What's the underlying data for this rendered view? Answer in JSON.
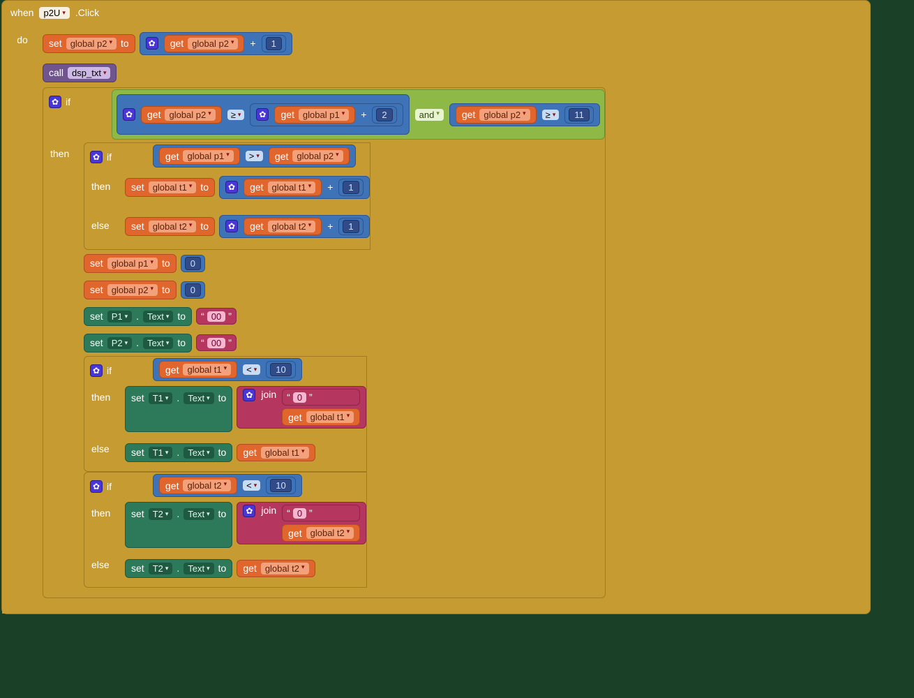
{
  "kw": {
    "when": "when",
    "do": "do",
    "call": "call",
    "if": "if",
    "then": "then",
    "else": "else",
    "set": "set",
    "to": "to",
    "get": "get",
    "join": "join",
    "and": "and",
    "click": ".Click"
  },
  "event": {
    "component": "p2U"
  },
  "call_proc": "dsp_txt",
  "vars": {
    "p1": "global p1",
    "p2": "global p2",
    "t1": "global t1",
    "t2": "global t2"
  },
  "comps": {
    "P1": "P1",
    "P2": "P2",
    "T1": "T1",
    "T2": "T2"
  },
  "prop_text": "Text",
  "ops": {
    "ge": "≥",
    "gt": ">",
    "lt": "<",
    "plus": "+"
  },
  "nums": {
    "one": "1",
    "two": "2",
    "ten": "10",
    "eleven": "11",
    "zero": "0"
  },
  "strs": {
    "zerozero": "00",
    "zero": "0"
  },
  "dot": "."
}
